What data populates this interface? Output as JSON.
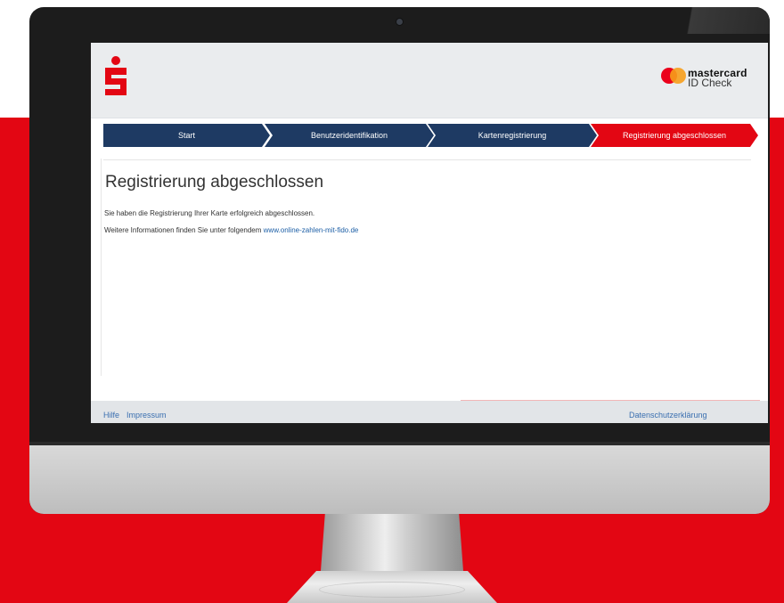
{
  "header": {
    "logo": "sparkasse-logo",
    "partner_logo": {
      "brand": "mastercard",
      "product": "ID Check"
    }
  },
  "progress_steps": [
    {
      "label": "Start",
      "state": "done"
    },
    {
      "label": "Benutzeridentifikation",
      "state": "done"
    },
    {
      "label": "Kartenregistrierung",
      "state": "done"
    },
    {
      "label": "Registrierung abgeschlossen",
      "state": "active"
    }
  ],
  "main": {
    "title": "Registrierung abgeschlossen",
    "message": "Sie haben die Registrierung Ihrer Karte erfolgreich abgeschlossen.",
    "info_prefix": "Weitere Informationen finden Sie unter folgendem",
    "info_link": "www.online-zahlen-mit-fido.de"
  },
  "footer": {
    "help": "Hilfe",
    "imprint": "Impressum",
    "privacy": "Datenschutzerklärung"
  },
  "colors": {
    "brand_red": "#e30613",
    "step_done": "#1e3a63",
    "step_active": "#e30613",
    "link": "#1d5fa6",
    "mc_red": "#eb001b",
    "mc_orange": "#f79e1b"
  }
}
